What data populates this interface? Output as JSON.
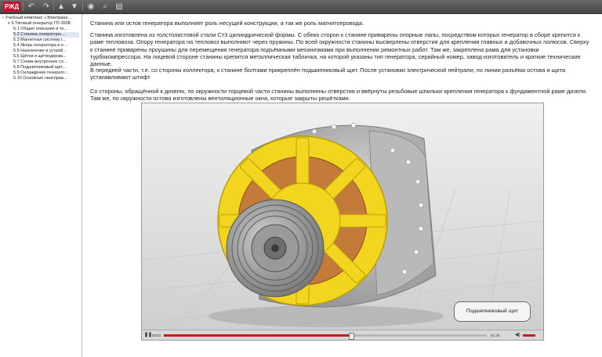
{
  "toolbar": {
    "logo": "РЖД",
    "undo_icon": "↶",
    "redo_icon": "↷",
    "up_icon": "▲",
    "down_icon": "▼",
    "print_icon": "◉",
    "search_icon": "⌕",
    "export_icon": "▤"
  },
  "sidebar": {
    "items": [
      {
        "label": "Учебный комплекс «Электрине...",
        "indent": 0,
        "expander": "▪"
      },
      {
        "label": "5 Тяговый генератор ГП-300Б",
        "indent": 1,
        "expander": "▾"
      },
      {
        "label": "5.1 Общее описание и те...",
        "indent": 2
      },
      {
        "label": "5.2 Станина генератора ...",
        "indent": 2,
        "selected": true
      },
      {
        "label": "5.3 Магнитная система г...",
        "indent": 2
      },
      {
        "label": "5.4 Якорь генератора и е...",
        "indent": 2
      },
      {
        "label": "5.5  Назначение и устрой...",
        "indent": 2
      },
      {
        "label": "5.6 Щётки и щёткодержа...",
        "indent": 2
      },
      {
        "label": "5.7 Схема внутренних со...",
        "indent": 2
      },
      {
        "label": "5.8 Подшипниковый щит...",
        "indent": 2
      },
      {
        "label": "5.9 Охлаждение генерато...",
        "indent": 2
      },
      {
        "label": "5.10 Основные неисправ...",
        "indent": 2
      }
    ]
  },
  "content": {
    "paragraphs": [
      "Станина или остов генератора выполняет роль несущей конструкции, а так же роль магнитопровода.",
      "Станина изготовлена из толстолистовой стали Ст3 цилиндрической формы. С обеих сторон к станине приварены опорные лапы, посредством которых генератор в сборе крепится к раме тепловоза. Опору генератора на тепловоз выполняют через пружины. По всей окружности станины высверлены отверстия для крепления главных и добавочных полюсов. Сверху к станине приварены проушины для перемещения генератора подъёмными механизмами при выполнении ремонтных работ. Там же, закреплена рама для установки турбокомпрессора. На лицевой стороне станины крепится металлическая табличка, на которой указаны тип генератора, серийный номер, завод-изготовитель и краткие технические данные.",
      "В передней части, т.е. со стороны коллектора, к станине болтами прикреплён подшипниковый щит. После установки электрической нейтрали, по линии разъёма остова и щита устанавливают штифт.",
      "Со стороны, обращённой к дизелю, по окружности торцевой части станины выполнены отверстия и ввёрнуты резьбовые шпильки крепления генератора к фундаментной раме дизеля. Там же, по окружности остова изготовлены вентиляционные окна, которые закрыты решётками."
    ]
  },
  "video": {
    "callout": "Подшипниковый щит",
    "time_current": "00:52",
    "time_total": "01:29",
    "progress": 0.58,
    "play_icon": "❚❚",
    "volume_icon": "◀)"
  },
  "colors": {
    "accent": "#cc1a1a",
    "frame": "#c7c7c7",
    "yellow": "#f2d51f"
  }
}
